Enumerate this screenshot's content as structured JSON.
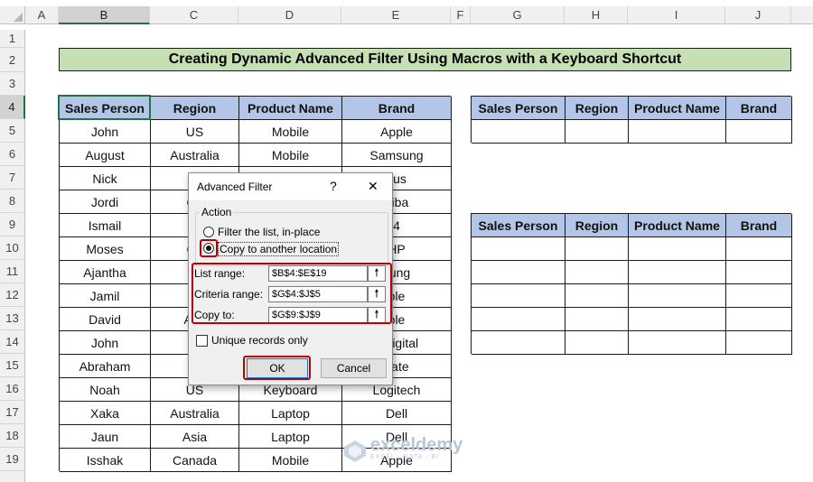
{
  "columns": [
    "A",
    "B",
    "C",
    "D",
    "E",
    "F",
    "G",
    "H",
    "I",
    "J"
  ],
  "rows": [
    "1",
    "2",
    "3",
    "4",
    "5",
    "6",
    "7",
    "8",
    "9",
    "10",
    "11",
    "12",
    "13",
    "14",
    "15",
    "16",
    "17",
    "18",
    "19"
  ],
  "title": "Creating Dynamic Advanced Filter Using Macros with a Keyboard Shortcut",
  "main_table": {
    "headers": [
      "Sales Person",
      "Region",
      "Product Name",
      "Brand"
    ],
    "rows": [
      [
        "John",
        "US",
        "Mobile",
        "Apple"
      ],
      [
        "August",
        "Australia",
        "Mobile",
        "Samsung"
      ],
      [
        "Nick",
        "",
        "",
        "sus"
      ],
      [
        "Jordi",
        "Ca",
        "",
        "hiba"
      ],
      [
        "Ismail",
        "A",
        "",
        "4"
      ],
      [
        "Moses",
        "Ca",
        "",
        "HP"
      ],
      [
        "Ajantha",
        "A",
        "",
        "sung"
      ],
      [
        "Jamil",
        "A",
        "",
        "ple"
      ],
      [
        "David",
        "Aus",
        "",
        "ple"
      ],
      [
        "John",
        "A",
        "",
        "n digital"
      ],
      [
        "Abraham",
        "A",
        "",
        "gate"
      ],
      [
        "Noah",
        "US",
        "Keyboard",
        "Logitech"
      ],
      [
        "Xaka",
        "Australia",
        "Laptop",
        "Dell"
      ],
      [
        "Jaun",
        "Asia",
        "Laptop",
        "Dell"
      ],
      [
        "Isshak",
        "Canada",
        "Mobile",
        "Apple"
      ]
    ]
  },
  "criteria_table": {
    "headers": [
      "Sales Person",
      "Region",
      "Product Name",
      "Brand"
    ]
  },
  "output_table": {
    "headers": [
      "Sales Person",
      "Region",
      "Product Name",
      "Brand"
    ]
  },
  "dialog": {
    "title": "Advanced Filter",
    "help": "?",
    "close": "✕",
    "action_label": "Action",
    "option_filter": "Filter the list, in-place",
    "option_copy": "Copy to another location",
    "list_range_label": "List range:",
    "list_range_value": "$B$4:$E$19",
    "criteria_range_label": "Criteria range:",
    "criteria_range_value": "$G$4:$J$5",
    "copy_to_label": "Copy to:",
    "copy_to_value": "$G$9:$J$9",
    "unique_label": "Unique records only",
    "ok_label": "OK",
    "cancel_label": "Cancel",
    "picker_glyph": "🠕"
  },
  "watermark": {
    "brand": "exceldemy",
    "tagline": "EXCEL · DATA · BI"
  }
}
